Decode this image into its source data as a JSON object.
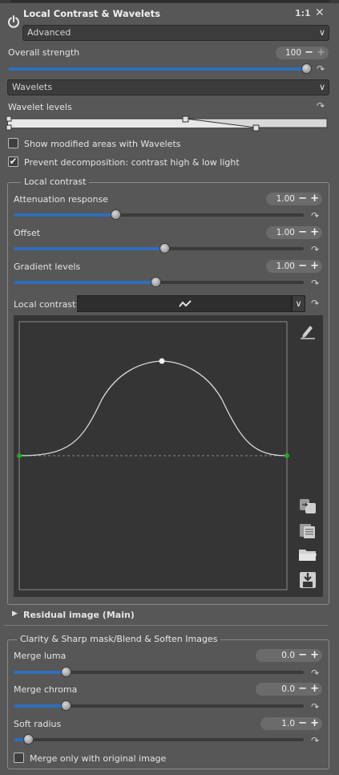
{
  "header": {
    "title": "Local Contrast & Wavelets",
    "one_to_one": "1:1",
    "close": "✕",
    "mode_value": "Advanced"
  },
  "overall": {
    "label": "Overall strength",
    "value": "100",
    "level_fraction": 1.0
  },
  "method": {
    "value": "Wavelets"
  },
  "wavelet_levels": {
    "label": "Wavelet levels"
  },
  "checks": {
    "show_modified": {
      "label": "Show modified areas with Wavelets",
      "checked": false
    },
    "prevent_decomp": {
      "label": "Prevent decomposition: contrast high & low light",
      "checked": true
    }
  },
  "local_contrast": {
    "section_title": "Local contrast",
    "attenuation": {
      "label": "Attenuation response",
      "value": "1.00",
      "level_fraction": 0.35
    },
    "offset": {
      "label": "Offset",
      "value": "1.00",
      "level_fraction": 0.52
    },
    "gradient": {
      "label": "Gradient levels",
      "value": "1.00",
      "level_fraction": 0.49
    },
    "curve_label": "Local contrast:"
  },
  "residual": {
    "label": "Residual image (Main)"
  },
  "clarity": {
    "section_title": "Clarity & Sharp mask/Blend & Soften Images",
    "merge_luma": {
      "label": "Merge luma",
      "value": "0.0",
      "level_fraction": 0.18
    },
    "merge_chroma": {
      "label": "Merge chroma",
      "value": "0.0",
      "level_fraction": 0.18
    },
    "soft_radius": {
      "label": "Soft radius",
      "value": "1.0",
      "level_fraction": 0.05
    },
    "merge_original": {
      "label": "Merge only with original image",
      "checked": false
    }
  },
  "icons": {
    "power": "power-icon",
    "reset": "reset-arrow-icon",
    "edit": "pencil-icon",
    "copy": "copy-icon",
    "paste": "paste-icon",
    "open": "folder-icon",
    "save": "save-icon"
  },
  "colors": {
    "accent": "#2f6fba",
    "panel": "#575757",
    "curve_bg": "#353535",
    "control_point_end": "#22aa22"
  }
}
